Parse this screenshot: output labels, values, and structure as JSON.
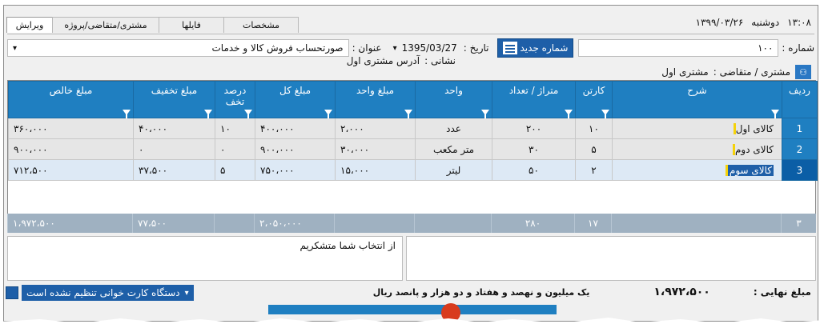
{
  "window": {
    "time": "۱۳:۰۸",
    "day": "دوشنبه",
    "date": "۱۳۹۹/۰۳/۲۶"
  },
  "tabs": [
    {
      "label": "ویرایش",
      "active": true
    },
    {
      "label": "مشتری/متقاضی/پروژه",
      "active": false
    },
    {
      "label": "فایلها",
      "active": false
    },
    {
      "label": "مشخصات",
      "active": false
    }
  ],
  "header": {
    "number_label": "شماره :",
    "number_value": "۱۰۰",
    "new_number_button": "شماره جدید",
    "date_label": "تاریخ :",
    "date_value": "1395/03/27",
    "title_label": "عنوان :",
    "title_value": "صورتحساب فروش کالا و خدمات",
    "customer_label": "مشتری / متقاضی :",
    "customer_value": "مشتری اول",
    "address_label": "نشانی :",
    "address_value": "آدرس مشتری اول"
  },
  "table": {
    "columns": [
      "ردیف",
      "شرح",
      "کارتن",
      "متراژ / تعداد",
      "واحد",
      "مبلغ واحد",
      "مبلغ کل",
      "درصد تخف",
      "مبلغ تخفیف",
      "مبلغ خالص"
    ],
    "rows": [
      {
        "rn": "1",
        "desc": "کالای اول",
        "carton": "۱۰",
        "qty": "۲۰۰",
        "unit": "عدد",
        "unit_price": "۲،۰۰۰",
        "total": "۴۰۰،۰۰۰",
        "disc_pct": "۱۰",
        "disc_amt": "۴۰،۰۰۰",
        "net": "۳۶۰،۰۰۰"
      },
      {
        "rn": "2",
        "desc": "کالای دوم",
        "carton": "۵",
        "qty": "۳۰",
        "unit": "متر مکعب",
        "unit_price": "۳۰،۰۰۰",
        "total": "۹۰۰،۰۰۰",
        "disc_pct": "۰",
        "disc_amt": "۰",
        "net": "۹۰۰،۰۰۰"
      },
      {
        "rn": "3",
        "desc": "کالای سوم",
        "carton": "۲",
        "qty": "۵۰",
        "unit": "لیتر",
        "unit_price": "۱۵،۰۰۰",
        "total": "۷۵۰،۰۰۰",
        "disc_pct": "۵",
        "disc_amt": "۳۷،۵۰۰",
        "net": "۷۱۲،۵۰۰"
      }
    ],
    "totals": {
      "rn": "۳",
      "carton": "۱۷",
      "qty": "۲۸۰",
      "total": "۲،۰۵۰،۰۰۰",
      "disc_amt": "۷۷،۵۰۰",
      "net": "۱،۹۷۲،۵۰۰"
    }
  },
  "notes": {
    "text": "از انتخاب شما متشکریم"
  },
  "footer": {
    "final_label": "مبلغ نهایی :",
    "final_value": "۱،۹۷۲،۵۰۰",
    "amount_words": "یک میلیون و نهصد و هفتاد و دو هزار و پانصد ریال",
    "card_reader": "دستگاه کارت خوانی تنظیم نشده است"
  }
}
